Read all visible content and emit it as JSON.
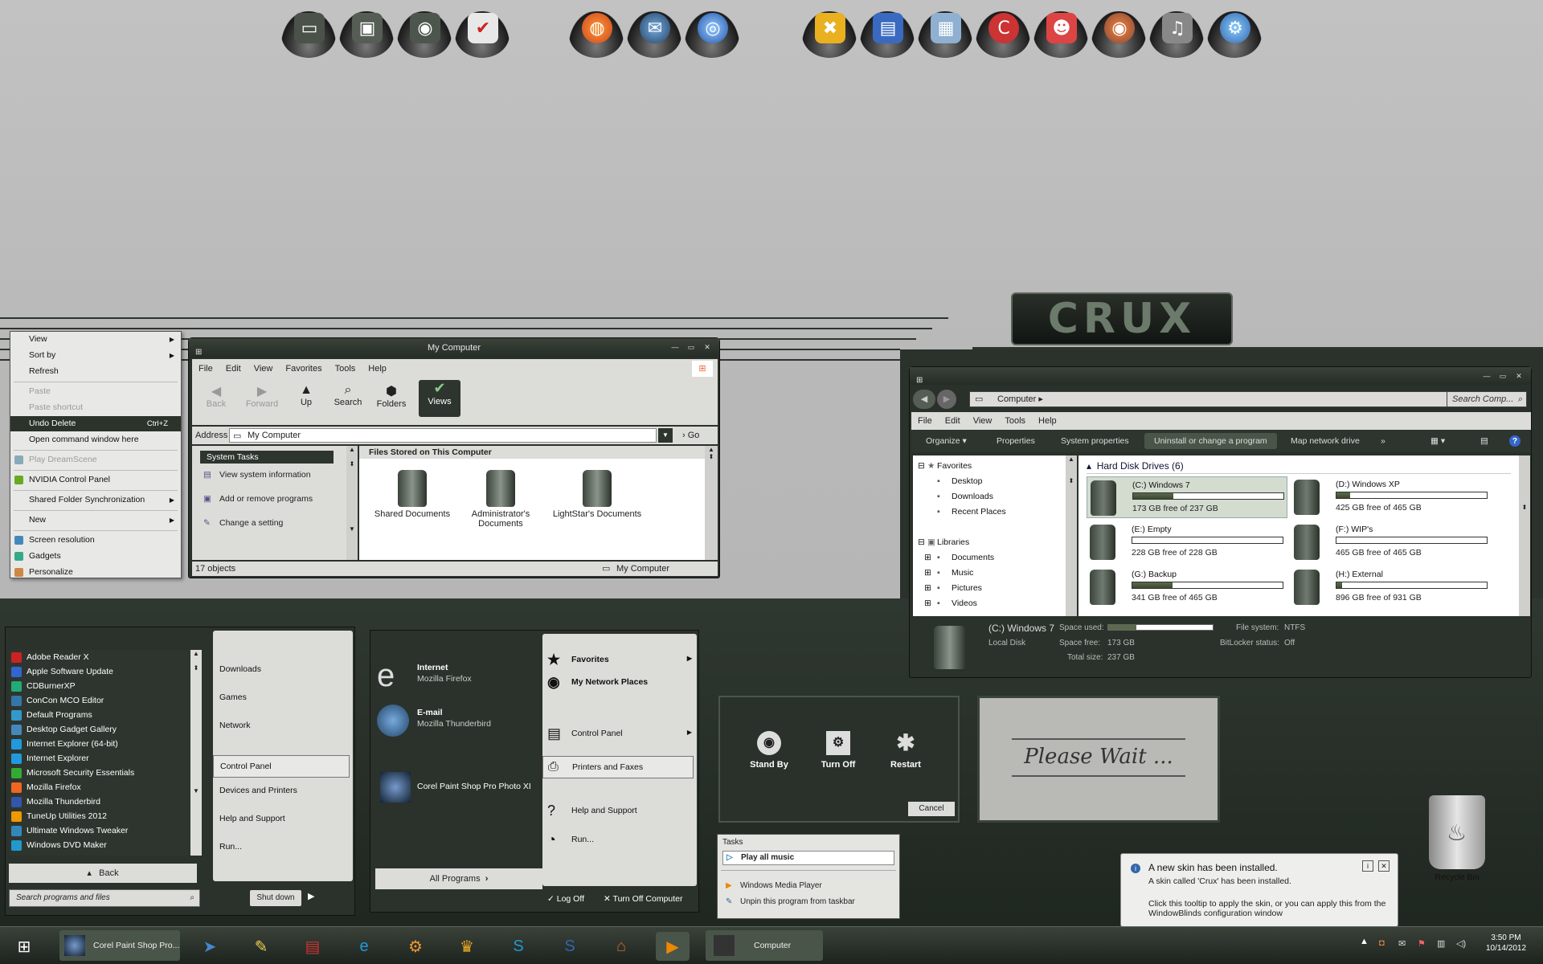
{
  "dock": {
    "group1": [
      "monitor-icon",
      "safe-icon",
      "network-icon",
      "checklist-icon"
    ],
    "group2": [
      "firefox-icon",
      "thunderbird-icon",
      "ie-icon"
    ],
    "group3": [
      "tools-icon",
      "display-icon",
      "network-drive-icon",
      "ccleaner-icon",
      "user-icon",
      "media-icon",
      "audio-icon",
      "settings-icon"
    ]
  },
  "logo": {
    "text": "CRUX"
  },
  "context_menu": {
    "items": [
      {
        "label": "View",
        "arrow": true
      },
      {
        "label": "Sort by",
        "arrow": true
      },
      {
        "label": "Refresh"
      },
      {
        "label": "Paste",
        "disabled": true
      },
      {
        "label": "Paste shortcut",
        "disabled": true
      },
      {
        "label": "Undo Delete",
        "shortcut": "Ctrl+Z",
        "selected": true
      },
      {
        "label": "Open command window here"
      },
      {
        "label": "Play DreamScene",
        "disabled": true
      },
      {
        "label": "NVIDIA Control Panel"
      },
      {
        "label": "Shared Folder Synchronization",
        "arrow": true
      },
      {
        "label": "New",
        "arrow": true
      },
      {
        "label": "Screen resolution"
      },
      {
        "label": "Gadgets"
      },
      {
        "label": "Personalize"
      }
    ]
  },
  "mycomputer": {
    "title": "My Computer",
    "menu": [
      "File",
      "Edit",
      "View",
      "Favorites",
      "Tools",
      "Help"
    ],
    "toolbar": [
      "Back",
      "Forward",
      "Up",
      "Search",
      "Folders",
      "Views"
    ],
    "address_label": "Address",
    "address_value": "My Computer",
    "go": "Go",
    "tasks_title": "System Tasks",
    "tasks": [
      "View system information",
      "Add or remove programs",
      "Change a setting"
    ],
    "files_title": "Files Stored on This Computer",
    "files": [
      "Shared Documents",
      "Administrator's Documents",
      "LightStar's Documents"
    ],
    "status_left": "17 objects",
    "status_right": "My Computer"
  },
  "explorer": {
    "breadcrumb": "Computer",
    "search_placeholder": "Search Comp...",
    "menu": [
      "File",
      "Edit",
      "View",
      "Tools",
      "Help"
    ],
    "commands": [
      "Organize",
      "Properties",
      "System properties",
      "Uninstall or change a program",
      "Map network drive",
      "»"
    ],
    "tree": {
      "favorites_label": "Favorites",
      "favorites": [
        "Desktop",
        "Downloads",
        "Recent Places"
      ],
      "libraries_label": "Libraries",
      "libraries": [
        "Documents",
        "Music",
        "Pictures",
        "Videos"
      ]
    },
    "group": "Hard Disk Drives (6)",
    "drives": [
      {
        "name": "(C:) Windows 7",
        "free": "173 GB free of 237 GB",
        "used": 0.27
      },
      {
        "name": "(D:) Windows XP",
        "free": "425 GB free of 465 GB",
        "used": 0.09
      },
      {
        "name": "(E:) Empty",
        "free": "228 GB free of 228 GB",
        "used": 0.0
      },
      {
        "name": "(F:) WIP's",
        "free": "465 GB free of 465 GB",
        "used": 0.0
      },
      {
        "name": "(G:) Backup",
        "free": "341 GB free of 465 GB",
        "used": 0.27
      },
      {
        "name": "(H:) External",
        "free": "896 GB free of 931 GB",
        "used": 0.04
      }
    ],
    "details": {
      "name": "(C:) Windows 7",
      "type": "Local Disk",
      "space_used_label": "Space used:",
      "space_free_label": "Space free:",
      "space_free": "173 GB",
      "total_label": "Total size:",
      "total": "237 GB",
      "fs_label": "File system:",
      "fs": "NTFS",
      "bitlocker_label": "BitLocker status:",
      "bitlocker": "Off",
      "used_frac": 0.27
    }
  },
  "startmenu1": {
    "programs": [
      {
        "label": "Adobe Reader X",
        "color": "#c22"
      },
      {
        "label": "Apple Software Update",
        "color": "#36c"
      },
      {
        "label": "CDBurnerXP",
        "color": "#2a7"
      },
      {
        "label": "ConCon MCO Editor",
        "color": "#37a"
      },
      {
        "label": "Default Programs",
        "color": "#39c"
      },
      {
        "label": "Desktop Gadget Gallery",
        "color": "#48b"
      },
      {
        "label": "Internet Explorer (64-bit)",
        "color": "#29d"
      },
      {
        "label": "Internet Explorer",
        "color": "#29d"
      },
      {
        "label": "Microsoft Security Essentials",
        "color": "#3a3"
      },
      {
        "label": "Mozilla Firefox",
        "color": "#e62"
      },
      {
        "label": "Mozilla Thunderbird",
        "color": "#35a"
      },
      {
        "label": "TuneUp Utilities 2012",
        "color": "#e90"
      },
      {
        "label": "Ultimate Windows Tweaker",
        "color": "#38b"
      },
      {
        "label": "Windows DVD Maker",
        "color": "#29c"
      }
    ],
    "right": [
      "Downloads",
      "Games",
      "Network",
      "Control Panel",
      "Devices and Printers",
      "Help and Support",
      "Run..."
    ],
    "back": "Back",
    "search_placeholder": "Search programs and files",
    "shutdown": "Shut down"
  },
  "startmenu2": {
    "pinned": [
      {
        "title": "Internet",
        "sub": "Mozilla Firefox"
      },
      {
        "title": "E-mail",
        "sub": "Mozilla Thunderbird"
      },
      {
        "title": "Corel Paint Shop Pro Photo XI",
        "sub": ""
      }
    ],
    "right": [
      "Favorites",
      "My Network Places",
      "Control Panel",
      "Printers and Faxes",
      "Help and Support",
      "Run..."
    ],
    "all_programs": "All Programs",
    "logoff": "Log Off",
    "turnoff": "Turn Off Computer"
  },
  "shutdown_dialog": {
    "buttons": [
      "Stand By",
      "Turn Off",
      "Restart"
    ],
    "cancel": "Cancel"
  },
  "wait": {
    "text": "Please Wait ..."
  },
  "jumplist": {
    "tasks_label": "Tasks",
    "play": "Play all music",
    "wmp": "Windows Media Player",
    "unpin": "Unpin this program from taskbar"
  },
  "balloon": {
    "title": "A new skin has been installed.",
    "line1": "A skin called 'Crux' has been installed.",
    "line2": "Click this tooltip to apply the skin, or you can apply this from the WindowBlinds configuration window"
  },
  "recycle": {
    "label": "Recycle Bin"
  },
  "taskbar": {
    "paintshop": "Corel Paint Shop Pro...",
    "computer": "Computer",
    "time": "3:50 PM",
    "date": "10/14/2012"
  }
}
